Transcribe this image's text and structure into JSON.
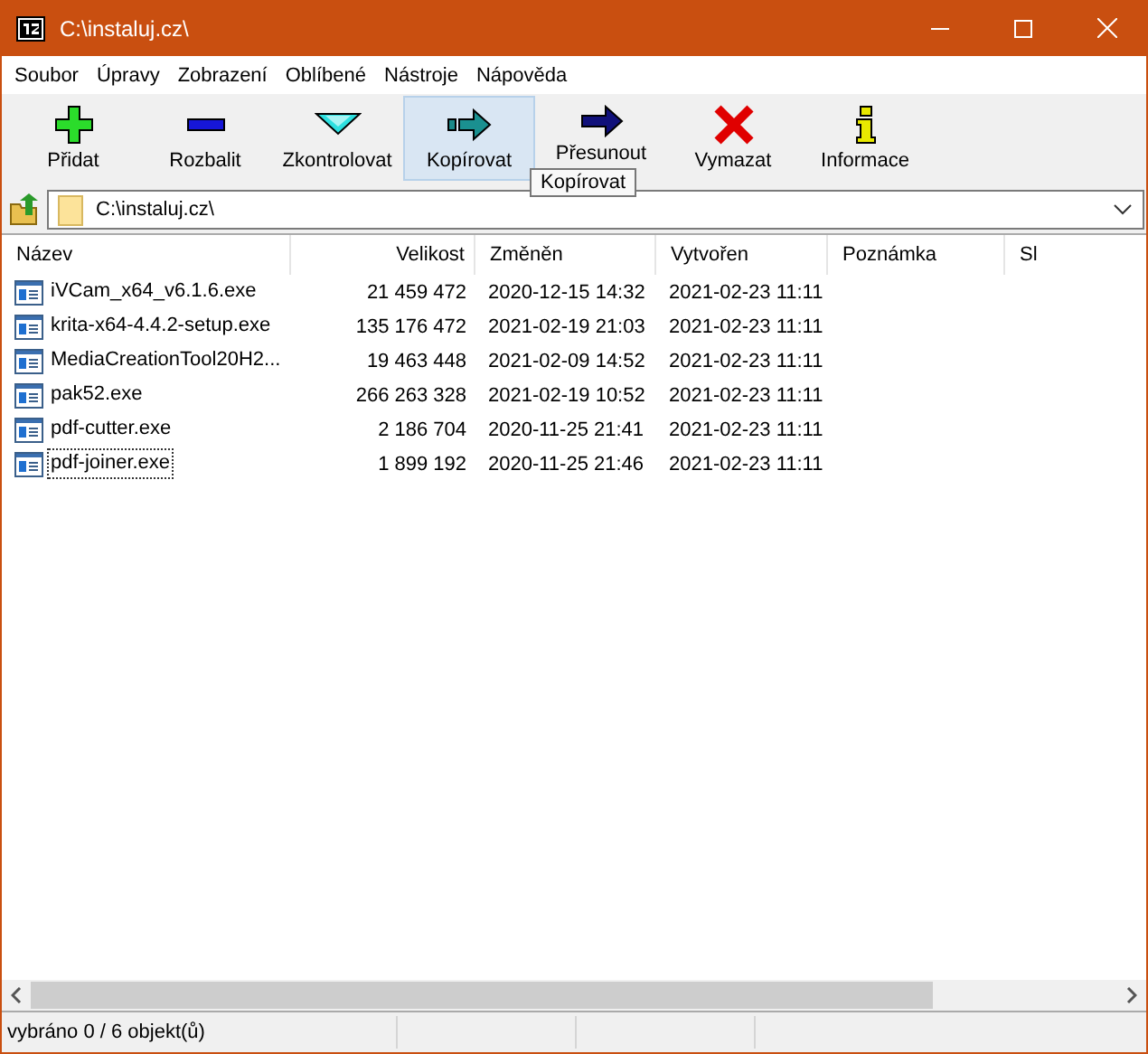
{
  "window": {
    "title": "C:\\instaluj.cz\\"
  },
  "menu": [
    {
      "label": "Soubor"
    },
    {
      "label": "Úpravy"
    },
    {
      "label": "Zobrazení"
    },
    {
      "label": "Oblíbené"
    },
    {
      "label": "Nástroje"
    },
    {
      "label": "Nápověda"
    }
  ],
  "toolbar": [
    {
      "label": "Přidat",
      "kind": "add",
      "hovered": false
    },
    {
      "label": "Rozbalit",
      "kind": "extract",
      "hovered": false
    },
    {
      "label": "Zkontrolovat",
      "kind": "test",
      "hovered": false
    },
    {
      "label": "Kopírovat",
      "kind": "copy",
      "hovered": true
    },
    {
      "label": "Přesunout",
      "kind": "move",
      "hovered": false
    },
    {
      "label": "Vymazat",
      "kind": "delete",
      "hovered": false
    },
    {
      "label": "Informace",
      "kind": "info",
      "hovered": false
    }
  ],
  "tooltip": "Kopírovat",
  "address": {
    "value": "C:\\instaluj.cz\\"
  },
  "table": {
    "columns": [
      "Název",
      "Velikost",
      "Změněn",
      "Vytvořen",
      "Poznámka",
      "Sl"
    ],
    "rows": [
      {
        "name": "iVCam_x64_v6.1.6.exe",
        "size": "21 459 472",
        "modified": "2020-12-15 14:32",
        "created": "2021-02-23 11:11",
        "focused": false
      },
      {
        "name": "krita-x64-4.4.2-setup.exe",
        "size": "135 176 472",
        "modified": "2021-02-19 21:03",
        "created": "2021-02-23 11:11",
        "focused": false
      },
      {
        "name": "MediaCreationTool20H2...",
        "size": "19 463 448",
        "modified": "2021-02-09 14:52",
        "created": "2021-02-23 11:11",
        "focused": false
      },
      {
        "name": "pak52.exe",
        "size": "266 263 328",
        "modified": "2021-02-19 10:52",
        "created": "2021-02-23 11:11",
        "focused": false
      },
      {
        "name": "pdf-cutter.exe",
        "size": "2 186 704",
        "modified": "2020-11-25 21:41",
        "created": "2021-02-23 11:11",
        "focused": false
      },
      {
        "name": "pdf-joiner.exe",
        "size": "1 899 192",
        "modified": "2020-11-25 21:46",
        "created": "2021-02-23 11:11",
        "focused": true
      }
    ]
  },
  "status_bar": {
    "text": "vybráno 0 / 6 objekt(ů)"
  }
}
